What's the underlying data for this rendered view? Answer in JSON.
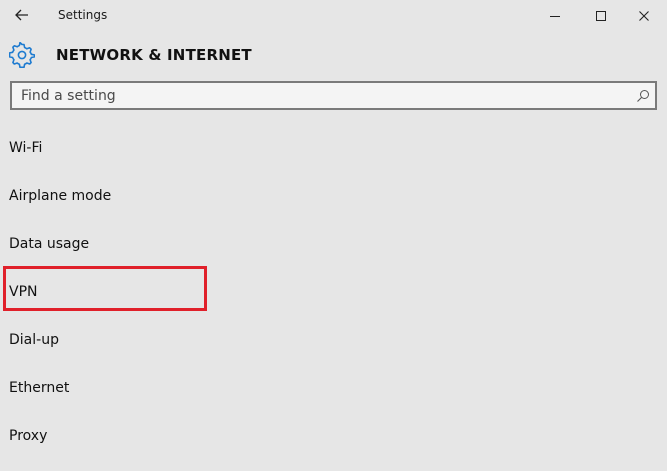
{
  "window": {
    "title": "Settings",
    "controls": {
      "minimize": "minimize",
      "maximize": "maximize",
      "close": "close"
    }
  },
  "header": {
    "icon": "gear-icon",
    "title": "NETWORK & INTERNET"
  },
  "search": {
    "placeholder": "Find a setting",
    "value": ""
  },
  "nav": {
    "items": [
      {
        "label": "Wi-Fi"
      },
      {
        "label": "Airplane mode"
      },
      {
        "label": "Data usage"
      },
      {
        "label": "VPN"
      },
      {
        "label": "Dial-up"
      },
      {
        "label": "Ethernet"
      },
      {
        "label": "Proxy"
      }
    ]
  },
  "colors": {
    "background": "#e6e6e6",
    "highlight": "#e0202a",
    "accent": "#1e7bd0"
  }
}
